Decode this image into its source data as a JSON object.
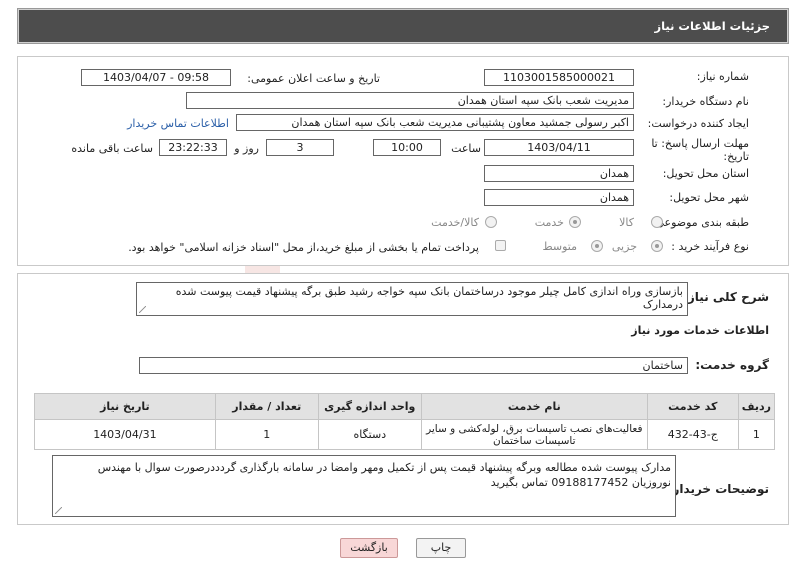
{
  "header": {
    "title": "جزئیات اطلاعات نیاز"
  },
  "form": {
    "need_number": {
      "label": "شماره نیاز:",
      "value": "1103001585000021"
    },
    "announce_datetime": {
      "label": "تاریخ و ساعت اعلان عمومی:",
      "value": "1403/04/07 - 09:58"
    },
    "buyer_org": {
      "label": "نام دستگاه خریدار:",
      "value": "مدیریت شعب بانک سپه استان همدان"
    },
    "requester": {
      "label": "ایجاد کننده درخواست:",
      "value": "اکبر رسولی جمشید معاون پشتیبانی مدیریت شعب بانک سپه استان همدان",
      "contact_link": "اطلاعات تماس خریدار"
    },
    "deadline": {
      "label": "مهلت ارسال پاسخ: تا تاریخ:",
      "date": "1403/04/11",
      "time_label": "ساعت",
      "time": "10:00",
      "days": "3",
      "days_label": "روز و",
      "remaining": "23:22:33",
      "remaining_label": "ساعت باقی مانده"
    },
    "delivery_province": {
      "label": "استان محل تحویل:",
      "value": "همدان"
    },
    "delivery_city": {
      "label": "شهر محل تحویل:",
      "value": "همدان"
    },
    "category": {
      "label": "طبقه بندی موضوعی:",
      "options": [
        "کالا",
        "خدمت",
        "کالا/خدمت"
      ],
      "selected": "خدمت"
    },
    "purchase_type": {
      "label": "نوع فرآیند خرید :",
      "options": [
        "جزیی",
        "متوسط"
      ],
      "selected": "جزیی",
      "note": "پرداخت تمام یا بخشی از مبلغ خرید،از محل \"اسناد خزانه اسلامی\" خواهد بود."
    }
  },
  "summary": {
    "label": "شرح کلی نیاز:",
    "text": "بازسازی وراه اندازی کامل چیلر موجود درساختمان بانک سپه خواجه رشید طبق برگه پیشنهاد قیمت پیوست شده درمدارک"
  },
  "services": {
    "section_title": "اطلاعات خدمات مورد نیاز",
    "group_label": "گروه خدمت:",
    "group_value": "ساختمان",
    "columns": [
      "ردیف",
      "کد خدمت",
      "نام خدمت",
      "واحد اندازه گیری",
      "تعداد / مقدار",
      "تاریخ نیاز"
    ],
    "rows": [
      {
        "row": "1",
        "code": "ج-43-432",
        "name": "فعالیت‌های نصب تاسیسات برق، لوله‌کشی و سایر تاسیسات ساختمان",
        "unit": "دستگاه",
        "qty": "1",
        "date": "1403/04/31"
      }
    ]
  },
  "buyer_notes": {
    "label": "توضیحات خریدار:",
    "text": "مدارک پیوست شده مطالعه وبرگه پیشنهاد قیمت پس از تکمیل ومهر وامضا در سامانه بارگذاری گردددرصورت سوال با مهندس نوروزیان 09188177452 تماس بگیرید"
  },
  "buttons": {
    "print": "چاپ",
    "back": "بازگشت"
  },
  "watermark": {
    "text": "AriaTender.neT"
  },
  "colors": {
    "title_bar": "#4d4d4d",
    "link": "#2b5fa8",
    "back_button": "#f8d7d7",
    "watermark": "#c0392b"
  }
}
